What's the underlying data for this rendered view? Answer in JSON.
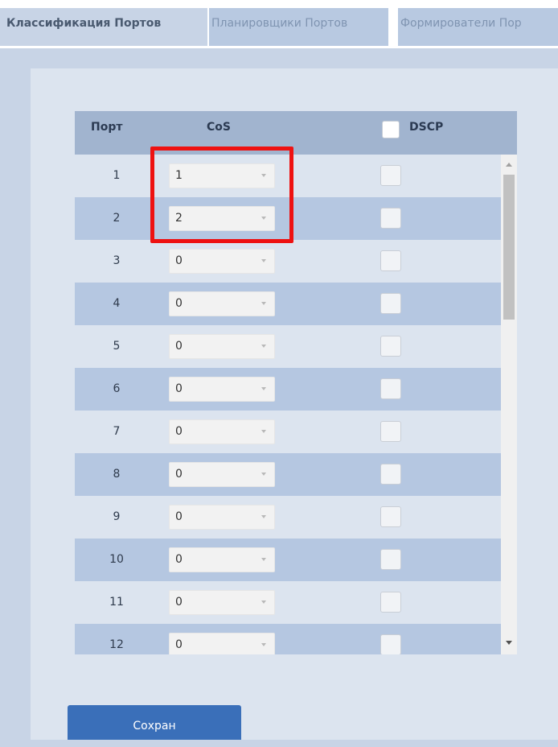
{
  "tabs": [
    {
      "label": "Классификация Портов",
      "active": true
    },
    {
      "label": "Планировщики Портов",
      "active": false
    },
    {
      "label": "Формирователи Пор",
      "active": false
    }
  ],
  "table": {
    "headers": {
      "port": "Порт",
      "cos": "CoS",
      "dscp": "DSCP"
    },
    "rows": [
      {
        "port": "1",
        "cos": "1"
      },
      {
        "port": "2",
        "cos": "2"
      },
      {
        "port": "3",
        "cos": "0"
      },
      {
        "port": "4",
        "cos": "0"
      },
      {
        "port": "5",
        "cos": "0"
      },
      {
        "port": "6",
        "cos": "0"
      },
      {
        "port": "7",
        "cos": "0"
      },
      {
        "port": "8",
        "cos": "0"
      },
      {
        "port": "9",
        "cos": "0"
      },
      {
        "port": "10",
        "cos": "0"
      },
      {
        "port": "11",
        "cos": "0"
      },
      {
        "port": "12",
        "cos": "0"
      }
    ]
  },
  "save_label": "Сохран",
  "colors": {
    "highlight": "#ee1111",
    "button": "#3a6fb9"
  }
}
